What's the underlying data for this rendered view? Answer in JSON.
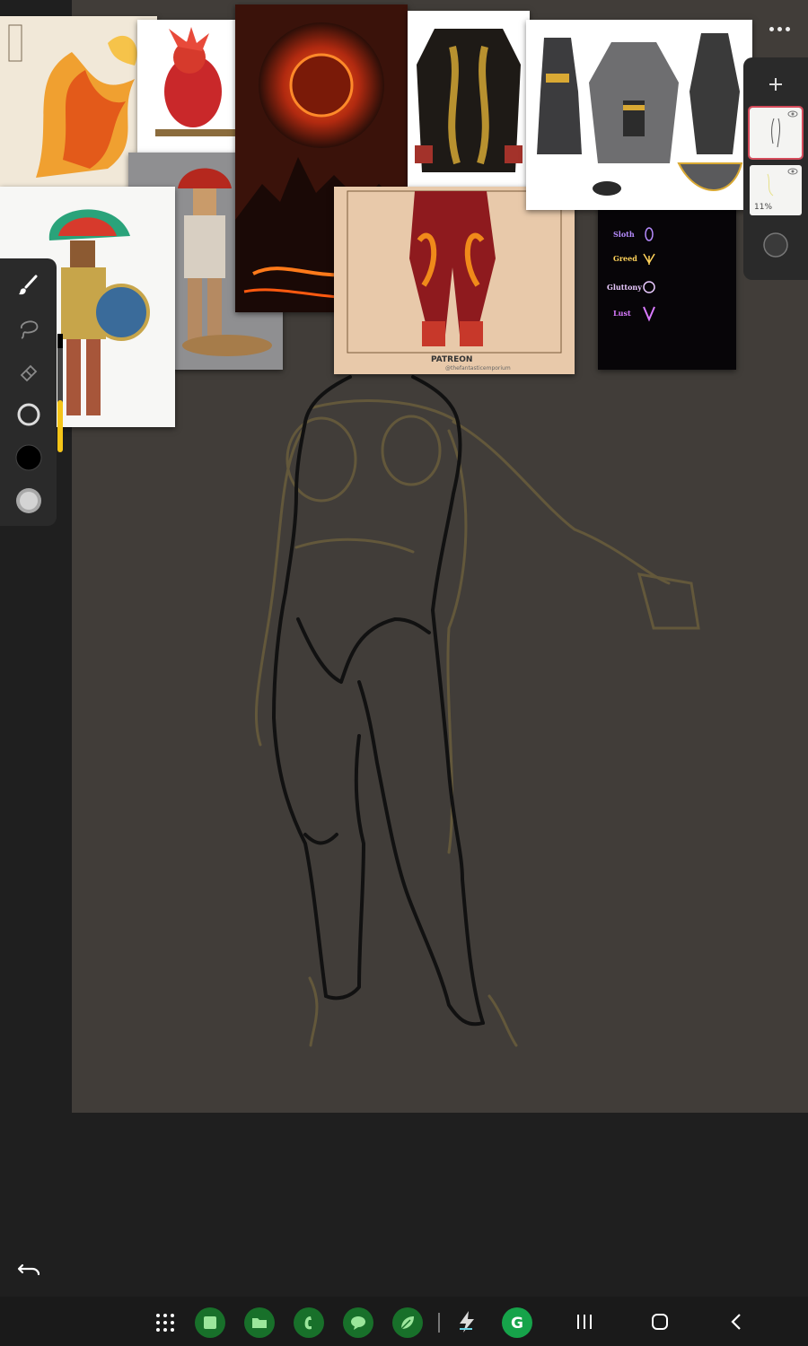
{
  "app": {
    "menu_icon": "more-horizontal-icon"
  },
  "toolbar": {
    "tools": [
      {
        "name": "brush-tool",
        "icon": "brush-icon"
      },
      {
        "name": "lasso-tool",
        "icon": "lasso-icon"
      },
      {
        "name": "eraser-tool",
        "icon": "eraser-icon"
      },
      {
        "name": "brush-size",
        "icon": "circle-outline-icon"
      },
      {
        "name": "color-swatch",
        "icon": "color-circle-icon",
        "color": "#000000"
      },
      {
        "name": "opacity-control",
        "icon": "soft-circle-icon"
      }
    ],
    "size_slider_color": "#f5c518"
  },
  "layers": {
    "add_icon": "plus-icon",
    "items": [
      {
        "name": "sketch-layer",
        "active": true,
        "visible": true
      },
      {
        "name": "guide-layer",
        "active": false,
        "visible": true,
        "opacity_label": "11%"
      }
    ],
    "blend_icon": "circle-icon"
  },
  "references": {
    "patreon_label": "PATREON",
    "patreon_handle": "@thefantasticemporium",
    "sins": [
      {
        "label": "Sloth",
        "color": "#b78cff"
      },
      {
        "label": "Greed",
        "color": "#ffd25a"
      },
      {
        "label": "Gluttony",
        "color": "#e9c9ff"
      },
      {
        "label": "Lust",
        "color": "#d97aff"
      }
    ]
  },
  "bottom": {
    "undo_icon": "undo-icon"
  },
  "navbar": {
    "apps": [
      "app-grid-icon",
      "notes-app-icon",
      "files-app-icon",
      "phone-app-icon",
      "messages-app-icon",
      "leaf-app-icon",
      "bolt-app-icon",
      "grammarly-app-icon"
    ],
    "system": [
      "recents-icon",
      "home-icon",
      "back-icon"
    ]
  },
  "colors": {
    "canvas": "#413d39",
    "background": "#1f1f1f",
    "accent_red": "#d54b5b",
    "sketch_line": "#111111",
    "guide_line": "#6a5d3c"
  }
}
